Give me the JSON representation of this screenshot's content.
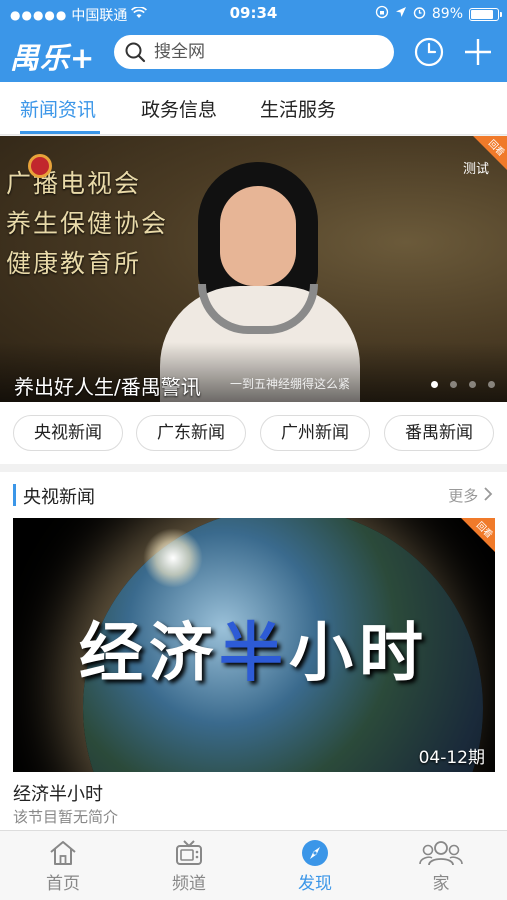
{
  "status_bar": {
    "carrier": "中国联通",
    "time": "09:34",
    "battery": "89%"
  },
  "header": {
    "logo": "禺乐+",
    "search_placeholder": "搜全网"
  },
  "tabs": [
    {
      "label": "新闻资讯",
      "active": true
    },
    {
      "label": "政务信息",
      "active": false
    },
    {
      "label": "生活服务",
      "active": false
    }
  ],
  "banner": {
    "background_text": [
      "广播电视会",
      "养生保健协会",
      "健康教育所"
    ],
    "tag": "测试",
    "corner_badge": "回看",
    "title": "养出好人生/番禺警讯",
    "subtitle": "一到五神经绷得这么紧",
    "page_count": 4,
    "current_page": 1
  },
  "chips": [
    "央视新闻",
    "广东新闻",
    "广州新闻",
    "番禺新闻"
  ],
  "section": {
    "title": "央视新闻",
    "more": "更多",
    "video": {
      "corner_badge": "回看",
      "title_part1": "经济",
      "title_part2": "半",
      "title_part3": "小时",
      "episode": "04-12期"
    },
    "program_title": "经济半小时",
    "program_desc": "该节目暂无简介"
  },
  "tabbar": [
    {
      "label": "首页",
      "icon": "home-icon",
      "active": false
    },
    {
      "label": "频道",
      "icon": "tv-icon",
      "active": false
    },
    {
      "label": "发现",
      "icon": "compass-icon",
      "active": true
    },
    {
      "label": "家",
      "icon": "family-icon",
      "active": false
    }
  ],
  "colors": {
    "accent": "#3b96e8",
    "badge": "#f07a2a"
  }
}
